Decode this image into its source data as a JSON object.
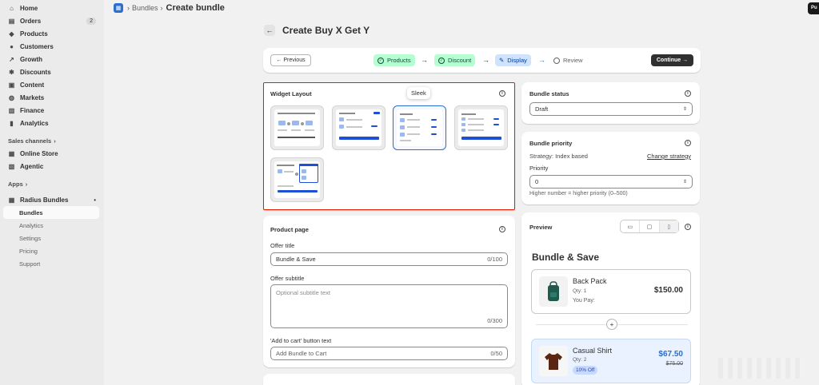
{
  "sidebar": {
    "items": [
      {
        "label": "Home",
        "icon": "home-icon",
        "glyph": "⌂"
      },
      {
        "label": "Orders",
        "icon": "orders-icon",
        "glyph": "▤",
        "badge": "2"
      },
      {
        "label": "Products",
        "icon": "tag-icon",
        "glyph": "◆"
      },
      {
        "label": "Customers",
        "icon": "person-icon",
        "glyph": "●"
      },
      {
        "label": "Growth",
        "icon": "growth-icon",
        "glyph": "↗"
      },
      {
        "label": "Discounts",
        "icon": "discount-icon",
        "glyph": "✱"
      },
      {
        "label": "Content",
        "icon": "content-icon",
        "glyph": "▣"
      },
      {
        "label": "Markets",
        "icon": "globe-icon",
        "glyph": "◍"
      },
      {
        "label": "Finance",
        "icon": "bank-icon",
        "glyph": "▥"
      },
      {
        "label": "Analytics",
        "icon": "chart-icon",
        "glyph": "▮"
      }
    ],
    "sales_channels_label": "Sales channels",
    "channels": [
      {
        "label": "Online Store",
        "glyph": "▦"
      },
      {
        "label": "Agentic",
        "glyph": "▧"
      }
    ],
    "apps_label": "Apps",
    "app": {
      "label": "Radius Bundles",
      "glyph": "▦",
      "more": "•"
    },
    "sub_items": [
      "Bundles",
      "Analytics",
      "Settings",
      "Pricing",
      "Support"
    ]
  },
  "topbar": {
    "crumb": "Bundles",
    "sep": "›",
    "title": "Create bundle",
    "right_btn": "Pu"
  },
  "page": {
    "back": "←",
    "title": "Create Buy X Get Y"
  },
  "stepper": {
    "previous": "← Previous",
    "continue": "Continue →",
    "steps": [
      {
        "label": "Products",
        "state": "done"
      },
      {
        "label": "Discount",
        "state": "done"
      },
      {
        "label": "Display",
        "state": "current"
      },
      {
        "label": "Review",
        "state": "todo"
      }
    ],
    "arrow": "→"
  },
  "widget": {
    "title": "Widget Layout",
    "tooltip": "Sleek",
    "info": "i"
  },
  "product_page": {
    "title": "Product page",
    "offer_title_label": "Offer title",
    "offer_title_value": "Bundle & Save",
    "offer_title_count": "0/100",
    "offer_subtitle_label": "Offer subtitle",
    "offer_subtitle_placeholder": "Optional subtitle text",
    "offer_subtitle_count": "0/300",
    "cart_label": "'Add to cart' button text",
    "cart_value": "Add Bundle to Cart",
    "cart_count": "0/50"
  },
  "bundle_status": {
    "title": "Bundle status",
    "value": "Draft"
  },
  "bundle_priority": {
    "title": "Bundle priority",
    "strategy": "Strategy: Index based",
    "change": "Change strategy",
    "priority_label": "Priority",
    "priority_value": "0",
    "help": "Higher number = higher priority (0–500)"
  },
  "preview": {
    "title": "Preview",
    "bundle_title": "Bundle & Save",
    "items": [
      {
        "name": "Back Pack",
        "qty": "Qty: 1",
        "you_pay": "You Pay:",
        "price": "$150.00"
      },
      {
        "name": "Casual Shirt",
        "qty": "Qty: 2",
        "badge": "10% Off",
        "price": "$67.50",
        "old_price": "$75.00"
      }
    ],
    "plus": "+"
  },
  "colors": {
    "accent": "#2c6ecb",
    "highlight_border": "#e51c00",
    "done_bg": "#b4fed2",
    "current_bg": "#cfe3ff"
  }
}
